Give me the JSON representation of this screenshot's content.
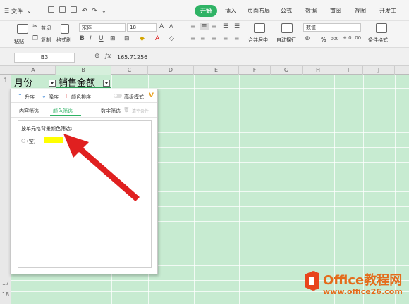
{
  "menubar": {
    "file": "文件",
    "tabs": [
      "开始",
      "插入",
      "页面布局",
      "公式",
      "数据",
      "审阅",
      "视图",
      "开发工"
    ],
    "active_tab": "开始"
  },
  "ribbon": {
    "paste": "粘贴",
    "cut": "剪切",
    "copy": "复制",
    "format_painter": "格式刷",
    "font_name": "宋体",
    "font_size": "18",
    "merge_center": "合并居中",
    "wrap_text": "自动换行",
    "number_format": "数值",
    "percent": "%",
    "thousands": "000",
    "conditional_format": "条件格式"
  },
  "formula_bar": {
    "cell_ref": "B3",
    "fx": "fx",
    "value": "165.71256"
  },
  "grid": {
    "columns": [
      "A",
      "B",
      "C",
      "D",
      "E",
      "F",
      "G",
      "H",
      "I",
      "J"
    ],
    "rows": [
      "1",
      "17",
      "18"
    ],
    "a1": "月份",
    "b1": "销售金额"
  },
  "filter_popup": {
    "sort_asc": "升序",
    "sort_desc": "降序",
    "sort_color": "颜色排序",
    "advanced_mode": "高级模式",
    "tab_content": "内容筛选",
    "tab_color": "颜色筛选",
    "number_filter": "数字筛选",
    "clear_condition": "清空条件",
    "section_label": "按单元格背景颜色筛选:",
    "empty_option": "(空)",
    "swatch_color": "#ffff00"
  },
  "watermark": {
    "title": "Office教程网",
    "url": "www.office26.com"
  }
}
